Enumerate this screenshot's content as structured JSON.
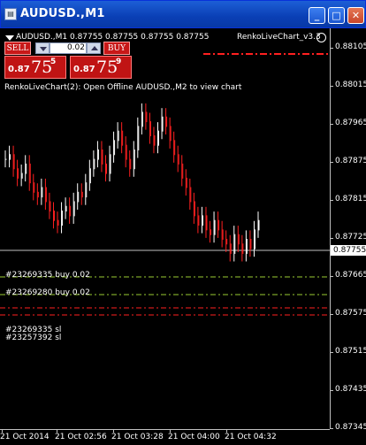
{
  "window": {
    "title": "AUDUSD.,M1",
    "minimize_label": "_",
    "maximize_label": "□",
    "close_label": "✕",
    "icon": "chart-window-icon"
  },
  "chart_header": {
    "symbol_line": "AUDUSD.,M1  0.87755 0.87755 0.87755 0.87755",
    "indicator_name": "RenkoLiveChart_v3.3"
  },
  "trade_panel": {
    "sell_label": "SELL",
    "buy_label": "BUY",
    "lot_value": "0.02",
    "sell_price_small": "0.87",
    "sell_price_big": "75",
    "sell_price_sup": "5",
    "buy_price_small": "0.87",
    "buy_price_big": "75",
    "buy_price_sup": "9"
  },
  "offline_message": "RenkoLiveChart(2): Open Offline AUDUSD.,M2 to view chart",
  "orders": [
    {
      "label": "#23269335 buy 0.02",
      "color": "#9acd32"
    },
    {
      "label": "#23269280 buy 0.02",
      "color": "#9acd32"
    },
    {
      "label": "#23269335 sl",
      "color": "#ff2020"
    },
    {
      "label": "#23257392 sl",
      "color": "#ff2020"
    }
  ],
  "current_price": "0.87755",
  "colors": {
    "background": "#000000",
    "candle_up": "#ffffff",
    "candle_down": "#ff2020",
    "sl_line": "#ff2020",
    "order_line": "#9acd32",
    "bid_line": "#c0c0c0"
  },
  "chart_data": {
    "type": "line",
    "title": "",
    "xlabel": "",
    "ylabel": "",
    "y_ticks": [
      "0.88105",
      "0.88015",
      "0.87965",
      "0.87875",
      "0.87815",
      "0.87725",
      "0.87665",
      "0.87575",
      "0.87515",
      "0.87435",
      "0.87345"
    ],
    "x_ticks": [
      "21 Oct 2014",
      "21 Oct 02:56",
      "21 Oct 03:28",
      "21 Oct 04:00",
      "21 Oct 04:32"
    ],
    "ylim": [
      0.8733,
      0.8812
    ],
    "horizontal_lines": [
      {
        "name": "bid",
        "value": 0.87755
      },
      {
        "name": "sl-top",
        "value": 0.8807
      },
      {
        "name": "buy-order-1",
        "value": 0.87702
      },
      {
        "name": "buy-order-2",
        "value": 0.8765
      },
      {
        "name": "sl-1",
        "value": 0.87615
      },
      {
        "name": "sl-2",
        "value": 0.87605
      }
    ],
    "series": [
      {
        "values": [
          0.8788,
          0.8789,
          0.8786,
          0.8784,
          0.8785,
          0.8787,
          0.8783,
          0.8781,
          0.878,
          0.8782,
          0.8779,
          0.8777,
          0.8775,
          0.8774,
          0.8777,
          0.8778,
          0.8776,
          0.8779,
          0.8781,
          0.878,
          0.8783,
          0.8786,
          0.8788,
          0.879,
          0.8787,
          0.8785,
          0.8789,
          0.8792,
          0.8794,
          0.8791,
          0.8788,
          0.8786,
          0.879,
          0.8795,
          0.8798,
          0.8796,
          0.8793,
          0.8791,
          0.8794,
          0.8797,
          0.8795,
          0.8792,
          0.8789,
          0.8787,
          0.8784,
          0.8782,
          0.8779,
          0.8776,
          0.8774,
          0.8776,
          0.8773,
          0.8772,
          0.8775,
          0.8773,
          0.8771,
          0.877,
          0.8768,
          0.8772,
          0.877,
          0.8768,
          0.8771,
          0.8769,
          0.8773,
          0.8775
        ]
      }
    ]
  }
}
